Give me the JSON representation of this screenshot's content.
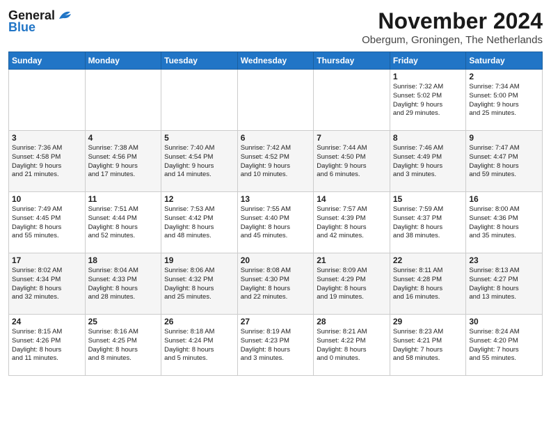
{
  "logo": {
    "line1": "General",
    "line2": "Blue"
  },
  "title": "November 2024",
  "subtitle": "Obergum, Groningen, The Netherlands",
  "weekdays": [
    "Sunday",
    "Monday",
    "Tuesday",
    "Wednesday",
    "Thursday",
    "Friday",
    "Saturday"
  ],
  "weeks": [
    [
      {
        "day": "",
        "info": ""
      },
      {
        "day": "",
        "info": ""
      },
      {
        "day": "",
        "info": ""
      },
      {
        "day": "",
        "info": ""
      },
      {
        "day": "",
        "info": ""
      },
      {
        "day": "1",
        "info": "Sunrise: 7:32 AM\nSunset: 5:02 PM\nDaylight: 9 hours\nand 29 minutes."
      },
      {
        "day": "2",
        "info": "Sunrise: 7:34 AM\nSunset: 5:00 PM\nDaylight: 9 hours\nand 25 minutes."
      }
    ],
    [
      {
        "day": "3",
        "info": "Sunrise: 7:36 AM\nSunset: 4:58 PM\nDaylight: 9 hours\nand 21 minutes."
      },
      {
        "day": "4",
        "info": "Sunrise: 7:38 AM\nSunset: 4:56 PM\nDaylight: 9 hours\nand 17 minutes."
      },
      {
        "day": "5",
        "info": "Sunrise: 7:40 AM\nSunset: 4:54 PM\nDaylight: 9 hours\nand 14 minutes."
      },
      {
        "day": "6",
        "info": "Sunrise: 7:42 AM\nSunset: 4:52 PM\nDaylight: 9 hours\nand 10 minutes."
      },
      {
        "day": "7",
        "info": "Sunrise: 7:44 AM\nSunset: 4:50 PM\nDaylight: 9 hours\nand 6 minutes."
      },
      {
        "day": "8",
        "info": "Sunrise: 7:46 AM\nSunset: 4:49 PM\nDaylight: 9 hours\nand 3 minutes."
      },
      {
        "day": "9",
        "info": "Sunrise: 7:47 AM\nSunset: 4:47 PM\nDaylight: 8 hours\nand 59 minutes."
      }
    ],
    [
      {
        "day": "10",
        "info": "Sunrise: 7:49 AM\nSunset: 4:45 PM\nDaylight: 8 hours\nand 55 minutes."
      },
      {
        "day": "11",
        "info": "Sunrise: 7:51 AM\nSunset: 4:44 PM\nDaylight: 8 hours\nand 52 minutes."
      },
      {
        "day": "12",
        "info": "Sunrise: 7:53 AM\nSunset: 4:42 PM\nDaylight: 8 hours\nand 48 minutes."
      },
      {
        "day": "13",
        "info": "Sunrise: 7:55 AM\nSunset: 4:40 PM\nDaylight: 8 hours\nand 45 minutes."
      },
      {
        "day": "14",
        "info": "Sunrise: 7:57 AM\nSunset: 4:39 PM\nDaylight: 8 hours\nand 42 minutes."
      },
      {
        "day": "15",
        "info": "Sunrise: 7:59 AM\nSunset: 4:37 PM\nDaylight: 8 hours\nand 38 minutes."
      },
      {
        "day": "16",
        "info": "Sunrise: 8:00 AM\nSunset: 4:36 PM\nDaylight: 8 hours\nand 35 minutes."
      }
    ],
    [
      {
        "day": "17",
        "info": "Sunrise: 8:02 AM\nSunset: 4:34 PM\nDaylight: 8 hours\nand 32 minutes."
      },
      {
        "day": "18",
        "info": "Sunrise: 8:04 AM\nSunset: 4:33 PM\nDaylight: 8 hours\nand 28 minutes."
      },
      {
        "day": "19",
        "info": "Sunrise: 8:06 AM\nSunset: 4:32 PM\nDaylight: 8 hours\nand 25 minutes."
      },
      {
        "day": "20",
        "info": "Sunrise: 8:08 AM\nSunset: 4:30 PM\nDaylight: 8 hours\nand 22 minutes."
      },
      {
        "day": "21",
        "info": "Sunrise: 8:09 AM\nSunset: 4:29 PM\nDaylight: 8 hours\nand 19 minutes."
      },
      {
        "day": "22",
        "info": "Sunrise: 8:11 AM\nSunset: 4:28 PM\nDaylight: 8 hours\nand 16 minutes."
      },
      {
        "day": "23",
        "info": "Sunrise: 8:13 AM\nSunset: 4:27 PM\nDaylight: 8 hours\nand 13 minutes."
      }
    ],
    [
      {
        "day": "24",
        "info": "Sunrise: 8:15 AM\nSunset: 4:26 PM\nDaylight: 8 hours\nand 11 minutes."
      },
      {
        "day": "25",
        "info": "Sunrise: 8:16 AM\nSunset: 4:25 PM\nDaylight: 8 hours\nand 8 minutes."
      },
      {
        "day": "26",
        "info": "Sunrise: 8:18 AM\nSunset: 4:24 PM\nDaylight: 8 hours\nand 5 minutes."
      },
      {
        "day": "27",
        "info": "Sunrise: 8:19 AM\nSunset: 4:23 PM\nDaylight: 8 hours\nand 3 minutes."
      },
      {
        "day": "28",
        "info": "Sunrise: 8:21 AM\nSunset: 4:22 PM\nDaylight: 8 hours\nand 0 minutes."
      },
      {
        "day": "29",
        "info": "Sunrise: 8:23 AM\nSunset: 4:21 PM\nDaylight: 7 hours\nand 58 minutes."
      },
      {
        "day": "30",
        "info": "Sunrise: 8:24 AM\nSunset: 4:20 PM\nDaylight: 7 hours\nand 55 minutes."
      }
    ]
  ]
}
